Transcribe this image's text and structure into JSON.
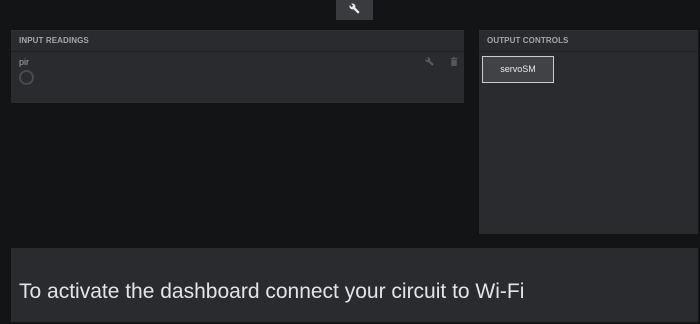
{
  "toolbar": {
    "icon": "wrench-icon"
  },
  "input_panel": {
    "title": "INPUT READINGS",
    "readings": [
      {
        "label": "pir",
        "indicator_icon": "circle-indicator-icon",
        "edit_icon": "wrench-icon",
        "delete_icon": "trash-icon"
      }
    ]
  },
  "output_panel": {
    "title": "OUTPUT CONTROLS",
    "controls": [
      {
        "label": "servoSM"
      }
    ]
  },
  "banner": {
    "message": "To activate the dashboard connect your circuit to Wi-Fi"
  },
  "colors": {
    "background": "#131416",
    "panel": "#2a2b2e",
    "text": "#e3e4e6",
    "muted": "#a4a6aa"
  }
}
